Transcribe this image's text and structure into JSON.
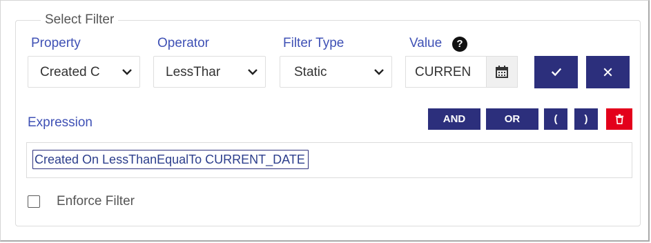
{
  "filter": {
    "legend": "Select Filter",
    "property": {
      "label": "Property",
      "value": "Created C"
    },
    "operator": {
      "label": "Operator",
      "value": "LessThar"
    },
    "filter_type": {
      "label": "Filter Type",
      "value": "Static"
    },
    "value": {
      "label": "Value",
      "help": "?",
      "text": "CURREN"
    },
    "confirm_icon": "check-icon",
    "cancel_icon": "close-icon"
  },
  "expression": {
    "label": "Expression",
    "buttons": {
      "and": "AND",
      "or": "OR",
      "open": "(",
      "close": ")"
    },
    "delete_icon": "trash-icon",
    "text": "Created On LessThanEqualTo CURRENT_DATE"
  },
  "enforce": {
    "label": "Enforce Filter",
    "checked": false
  },
  "colors": {
    "accent": "#2c2f7c",
    "label": "#3f51b5",
    "danger": "#e3001b"
  }
}
